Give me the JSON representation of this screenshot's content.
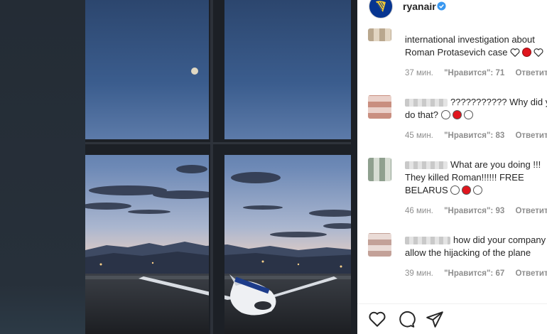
{
  "post": {
    "username": "ryanair",
    "verified": true
  },
  "comments": [
    {
      "line1": "international investigation about",
      "line2": "Roman Protasevich case",
      "time": "37 мин.",
      "likes": "\"Нравится\": 71",
      "reply": "Ответить"
    },
    {
      "line1": "??????????? Why did you",
      "line2": "do that?",
      "time": "45 мин.",
      "likes": "\"Нравится\": 83",
      "reply": "Ответить"
    },
    {
      "line1": "What are you doing !!!",
      "line2": "They killed Roman!!!!!! FREE",
      "line3": "BELARUS",
      "time": "46 мин.",
      "likes": "\"Нравится\": 93",
      "reply": "Ответить"
    },
    {
      "line1": "how did your company",
      "line2": "allow the hijacking of the plane",
      "time": "39 мин.",
      "likes": "\"Нравится\": 67",
      "reply": "Ответить"
    }
  ],
  "icons": {
    "like": "heart-outline-icon",
    "comment": "speech-bubble-icon",
    "share": "paper-plane-icon"
  },
  "colors": {
    "flag_red": "#e0161e",
    "ryanair_blue": "#073590",
    "verified_blue": "#3897f0"
  }
}
